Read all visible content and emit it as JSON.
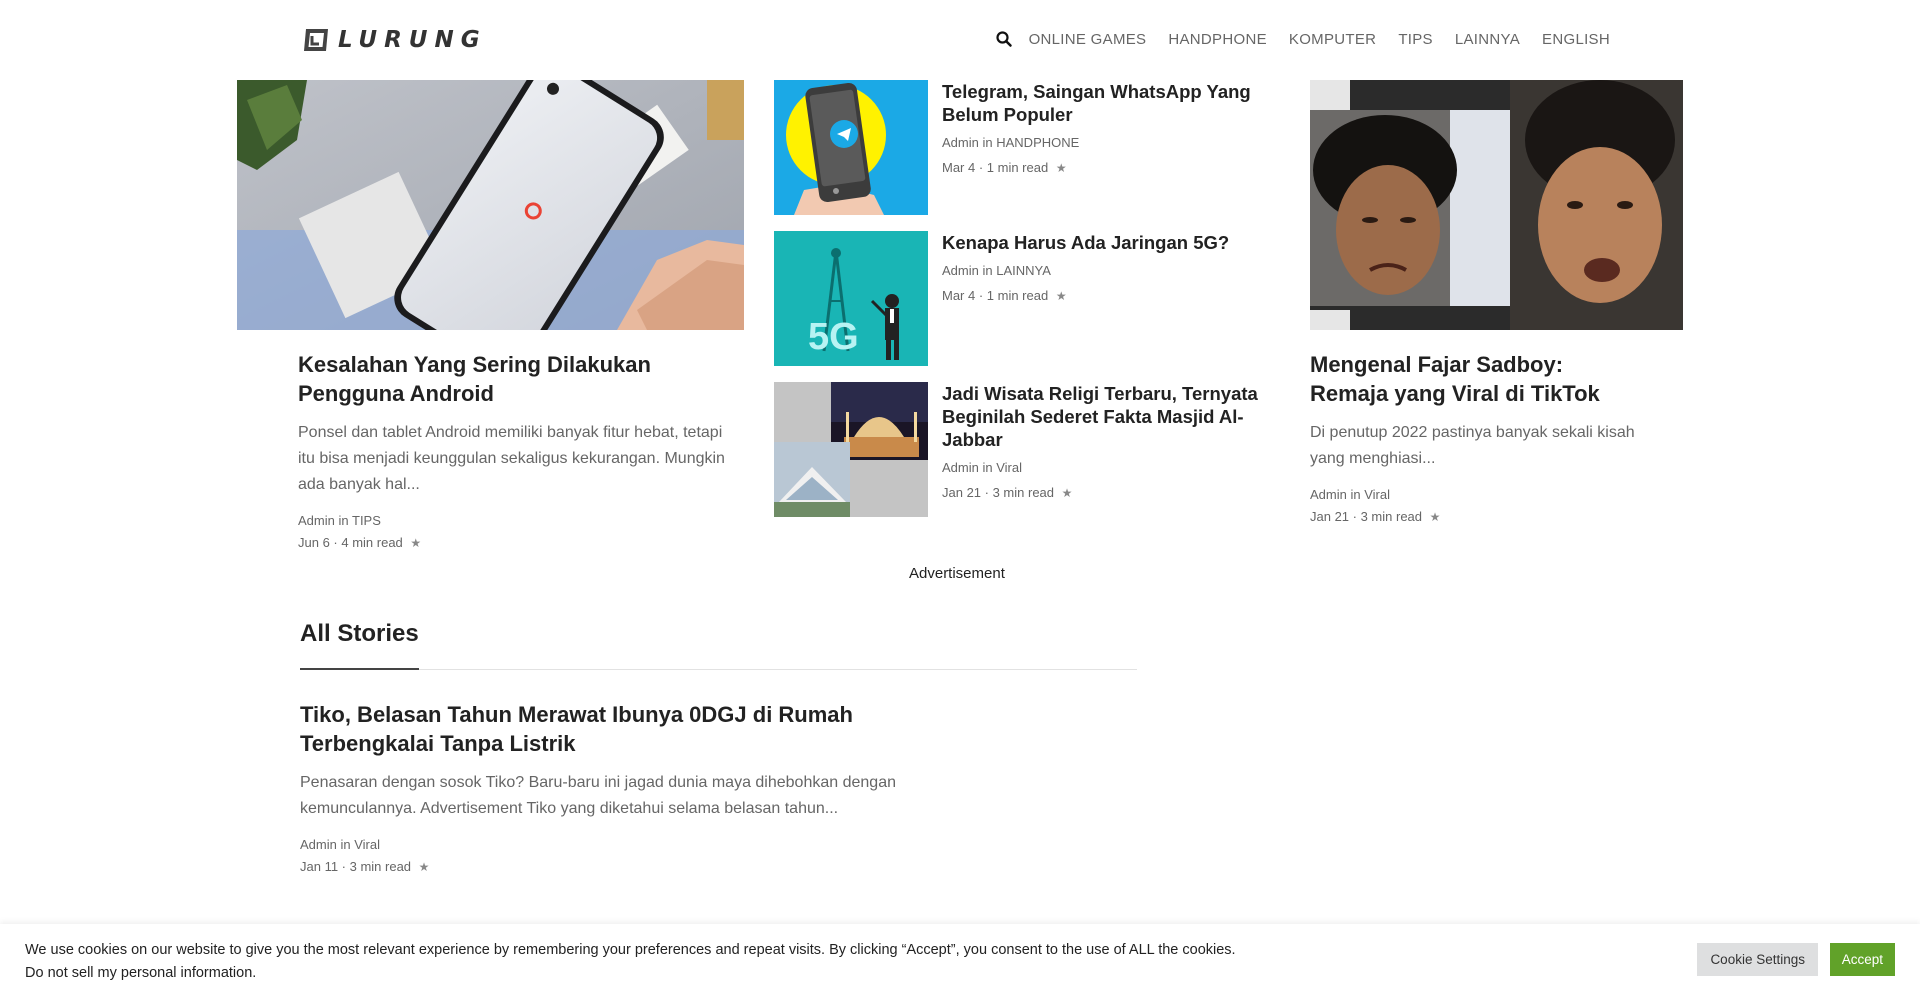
{
  "header": {
    "logo_text": "LURUNG",
    "nav": [
      "ONLINE GAMES",
      "HANDPHONE",
      "KOMPUTER",
      "TIPS",
      "LAINNYA",
      "ENGLISH"
    ]
  },
  "featured_left": {
    "title": "Kesalahan Yang Sering Dilakukan Pengguna Android",
    "excerpt": "Ponsel dan tablet Android memiliki banyak fitur hebat, tetapi itu bisa menjadi keunggulan sekaligus kekurangan. Mungkin ada banyak hal...",
    "author": "Admin",
    "in": "in",
    "category": "TIPS",
    "date_read": "Jun 6 · 4 min read",
    "star": "★"
  },
  "middle": [
    {
      "title": "Telegram, Saingan WhatsApp Yang Belum Populer",
      "author": "Admin",
      "in": "in",
      "category": "HANDPHONE",
      "date_read": "Mar 4 · 1 min read",
      "star": "★"
    },
    {
      "title": "Kenapa Harus Ada Jaringan 5G?",
      "author": "Admin",
      "in": "in",
      "category": "LAINNYA",
      "date_read": "Mar 4 · 1 min read",
      "star": "★",
      "thumb_text": "5G"
    },
    {
      "title": "Jadi Wisata Religi Terbaru, Ternyata Beginilah Sederet Fakta Masjid Al-Jabbar",
      "author": "Admin",
      "in": "in",
      "category": "Viral",
      "date_read": "Jan 21 · 3 min read",
      "star": "★"
    }
  ],
  "featured_right": {
    "title": "Mengenal Fajar Sadboy: Remaja yang Viral di TikTok",
    "excerpt": "Di penutup 2022 pastinya banyak sekali kisah yang menghiasi...",
    "author": "Admin",
    "in": "in",
    "category": "Viral",
    "date_read": "Jan 21 · 3 min read",
    "star": "★"
  },
  "advertisement_label": "Advertisement",
  "all_stories": {
    "heading": "All Stories",
    "items": [
      {
        "title": "Tiko, Belasan Tahun Merawat Ibunya 0DGJ di Rumah Terbengkalai Tanpa Listrik",
        "excerpt": "Penasaran dengan sosok Tiko? Baru-baru ini jagad dunia maya dihebohkan dengan kemunculannya. Advertisement Tiko yang diketahui selama belasan tahun...",
        "author": "Admin",
        "in": "in",
        "category": "Viral",
        "date_read": "Jan 11 · 3 min read",
        "star": "★"
      }
    ]
  },
  "cookie": {
    "text": "We use cookies on our website to give you the most relevant experience by remembering your preferences and repeat visits. By clicking “Accept”, you consent to the use of ALL the cookies.",
    "link": "Do not sell my personal information.",
    "settings_label": "Cookie Settings",
    "accept_label": "Accept"
  },
  "colors": {
    "accept_green": "#61a229",
    "telegram_blue": "#1ba9e6",
    "telegram_yellow": "#fff200",
    "fiveg_teal": "#19b5b5"
  }
}
